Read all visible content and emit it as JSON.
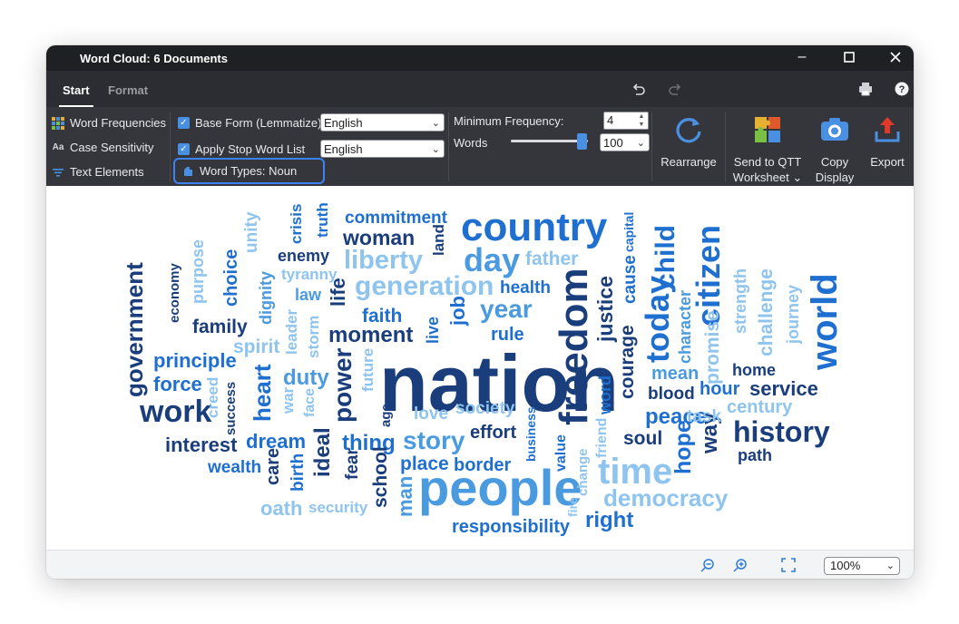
{
  "window": {
    "title": "Word Cloud: 6 Documents"
  },
  "tabs": [
    "Start",
    "Format"
  ],
  "ribbon": {
    "word_frequencies": "Word Frequencies",
    "case_sensitivity": "Case Sensitivity",
    "text_elements": "Text Elements",
    "base_form": "Base Form (Lemmatize)",
    "base_form_language": "English",
    "apply_stop": "Apply Stop Word List",
    "stop_language": "English",
    "word_types": "Word Types: Noun",
    "min_frequency_label": "Minimum Frequency:",
    "min_frequency_value": "4",
    "words_label": "Words",
    "words_value": "100",
    "words_slider_level": 1.0,
    "rearrange": "Rearrange",
    "send_line1": "Send to QTT",
    "send_line2": "Worksheet",
    "copy_line1": "Copy",
    "copy_line2": "Display",
    "export": "Export"
  },
  "icons": {
    "close": "close-icon",
    "maximize": "maximize-icon",
    "minimize": "minimize-icon",
    "undo": "undo-icon",
    "redo": "redo-icon",
    "print": "print-icon",
    "help": "help-icon"
  },
  "colors": {
    "dark_blue": "#1a3d7c",
    "mid_blue": "#1f6fd1",
    "light_blue": "#8ec4ee",
    "accent": "#3b82f6"
  },
  "status": {
    "zoom": "100%"
  },
  "cloud_words": [
    {
      "text": "nation",
      "color": "#1a3d7c"
    },
    {
      "text": "people",
      "color": "#4a9ae0"
    },
    {
      "text": "country",
      "color": "#1f6fd1"
    },
    {
      "text": "freedom",
      "color": "#1a3d7c"
    },
    {
      "text": "citizen",
      "color": "#1f6fd1"
    },
    {
      "text": "world",
      "color": "#1f6fd1"
    },
    {
      "text": "history",
      "color": "#1a3d7c"
    },
    {
      "text": "time",
      "color": "#8ec4ee"
    },
    {
      "text": "work",
      "color": "#1a3d7c"
    },
    {
      "text": "generation",
      "color": "#8ec4ee"
    },
    {
      "text": "liberty",
      "color": "#8ec4ee"
    },
    {
      "text": "day",
      "color": "#4a9ae0"
    },
    {
      "text": "year",
      "color": "#4a9ae0"
    },
    {
      "text": "today",
      "color": "#1f6fd1"
    },
    {
      "text": "child",
      "color": "#1f6fd1"
    },
    {
      "text": "government",
      "color": "#1a3d7c"
    },
    {
      "text": "democracy",
      "color": "#8ec4ee"
    },
    {
      "text": "story",
      "color": "#4a9ae0"
    },
    {
      "text": "moment",
      "color": "#1a3d7c"
    },
    {
      "text": "woman",
      "color": "#1a3d7c"
    },
    {
      "text": "commitment",
      "color": "#1f6fd1"
    },
    {
      "text": "responsibility",
      "color": "#1f6fd1"
    },
    {
      "text": "power",
      "color": "#1a3d7c"
    },
    {
      "text": "peace",
      "color": "#1f6fd1"
    },
    {
      "text": "right",
      "color": "#1f6fd1"
    },
    {
      "text": "heart",
      "color": "#1f6fd1"
    },
    {
      "text": "duty",
      "color": "#4a9ae0"
    },
    {
      "text": "thing",
      "color": "#1f6fd1"
    },
    {
      "text": "justice",
      "color": "#1a3d7c"
    },
    {
      "text": "challenge",
      "color": "#8ec4ee"
    },
    {
      "text": "promise",
      "color": "#8ec4ee"
    },
    {
      "text": "service",
      "color": "#1a3d7c"
    },
    {
      "text": "century",
      "color": "#8ec4ee"
    },
    {
      "text": "interest",
      "color": "#1a3d7c"
    },
    {
      "text": "dream",
      "color": "#1f6fd1"
    },
    {
      "text": "place",
      "color": "#1f6fd1"
    },
    {
      "text": "border",
      "color": "#1f6fd1"
    },
    {
      "text": "ideal",
      "color": "#1a3d7c"
    },
    {
      "text": "principle",
      "color": "#1f6fd1"
    },
    {
      "text": "force",
      "color": "#1f6fd1"
    },
    {
      "text": "family",
      "color": "#1a3d7c"
    },
    {
      "text": "spirit",
      "color": "#8ec4ee"
    },
    {
      "text": "faith",
      "color": "#1f6fd1"
    },
    {
      "text": "job",
      "color": "#1f6fd1"
    },
    {
      "text": "rule",
      "color": "#1f6fd1"
    },
    {
      "text": "father",
      "color": "#8ec4ee"
    },
    {
      "text": "health",
      "color": "#1f6fd1"
    },
    {
      "text": "hope",
      "color": "#1f6fd1"
    },
    {
      "text": "way",
      "color": "#1a3d7c"
    },
    {
      "text": "mean",
      "color": "#4a9ae0"
    },
    {
      "text": "hour",
      "color": "#1f6fd1"
    },
    {
      "text": "blood",
      "color": "#1a3d7c"
    },
    {
      "text": "task",
      "color": "#8ec4ee"
    },
    {
      "text": "soul",
      "color": "#1a3d7c"
    },
    {
      "text": "path",
      "color": "#1a3d7c"
    },
    {
      "text": "home",
      "color": "#1a3d7c"
    },
    {
      "text": "courage",
      "color": "#1a3d7c"
    },
    {
      "text": "cause",
      "color": "#1f6fd1"
    },
    {
      "text": "character",
      "color": "#4a9ae0"
    },
    {
      "text": "strength",
      "color": "#8ec4ee"
    },
    {
      "text": "journey",
      "color": "#8ec4ee"
    },
    {
      "text": "society",
      "color": "#8ec4ee"
    },
    {
      "text": "love",
      "color": "#8ec4ee"
    },
    {
      "text": "effort",
      "color": "#1a3d7c"
    },
    {
      "text": "wealth",
      "color": "#1f6fd1"
    },
    {
      "text": "oath",
      "color": "#8ec4ee"
    },
    {
      "text": "security",
      "color": "#8ec4ee"
    },
    {
      "text": "school",
      "color": "#1a3d7c"
    },
    {
      "text": "man",
      "color": "#4a9ae0"
    },
    {
      "text": "care",
      "color": "#1a3d7c"
    },
    {
      "text": "birth",
      "color": "#1f6fd1"
    },
    {
      "text": "fear",
      "color": "#1a3d7c"
    },
    {
      "text": "enemy",
      "color": "#1a3d7c"
    },
    {
      "text": "tyranny",
      "color": "#8ec4ee"
    },
    {
      "text": "law",
      "color": "#4a9ae0"
    },
    {
      "text": "crisis",
      "color": "#1f6fd1"
    },
    {
      "text": "truth",
      "color": "#1f6fd1"
    },
    {
      "text": "land",
      "color": "#1a3d7c"
    },
    {
      "text": "unity",
      "color": "#8ec4ee"
    },
    {
      "text": "dignity",
      "color": "#4a9ae0"
    },
    {
      "text": "purpose",
      "color": "#8ec4ee"
    },
    {
      "text": "choice",
      "color": "#1f6fd1"
    },
    {
      "text": "economy",
      "color": "#1a3d7c"
    },
    {
      "text": "leader",
      "color": "#8ec4ee"
    },
    {
      "text": "storm",
      "color": "#8ec4ee"
    },
    {
      "text": "life",
      "color": "#1a3d7c"
    },
    {
      "text": "live",
      "color": "#1f6fd1"
    },
    {
      "text": "creed",
      "color": "#8ec4ee"
    },
    {
      "text": "success",
      "color": "#1a3d7c"
    },
    {
      "text": "war",
      "color": "#8ec4ee"
    },
    {
      "text": "face",
      "color": "#8ec4ee"
    },
    {
      "text": "future",
      "color": "#8ec4ee"
    },
    {
      "text": "age",
      "color": "#1a3d7c"
    },
    {
      "text": "business",
      "color": "#1f6fd1"
    },
    {
      "text": "value",
      "color": "#1f6fd1"
    },
    {
      "text": "change",
      "color": "#8ec4ee"
    },
    {
      "text": "fire",
      "color": "#8ec4ee"
    },
    {
      "text": "friend",
      "color": "#8ec4ee"
    },
    {
      "text": "word",
      "color": "#1f6fd1"
    },
    {
      "text": "capital",
      "color": "#1f6fd1"
    }
  ]
}
